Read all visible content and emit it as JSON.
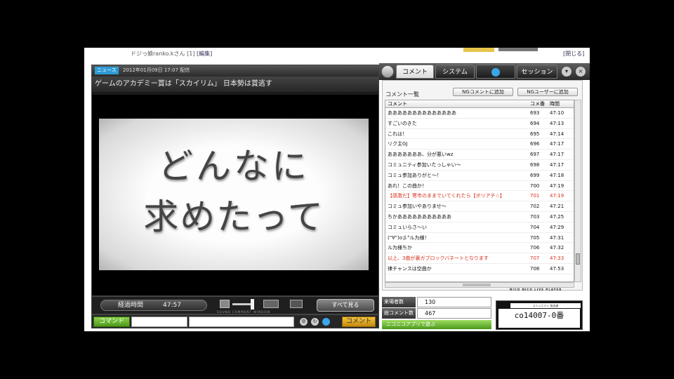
{
  "top": {
    "user": "ドジっ娘ranko.kさん",
    "page_count": "[1]",
    "edit_link": "[編集]",
    "close_link": "[閉じる]"
  },
  "player": {
    "news_tag": "ニュース",
    "datetime": "2012年01月09日 17:07 配信",
    "title": "ゲームのアカデミー賞は「スカイリム」 日本勢は賞逃す",
    "slide_line1": "どんなに",
    "slide_line2": "求めたって"
  },
  "controls": {
    "elapsed_label": "経過時間",
    "elapsed_value": "47:57",
    "control_labels": "SOUND  COMMENT  WINDOW",
    "pill_button": "すべて見る"
  },
  "input": {
    "command_button": "コマンド",
    "command_value": "",
    "comment_value": "",
    "post_button": "コメント"
  },
  "tabs": {
    "comment": "コメント",
    "system": "システム",
    "session": "セッション"
  },
  "comments_panel": {
    "header": "コメント一覧",
    "ng_comment_button": "NGコメントに追加",
    "ng_user_button": "NGユーザーに追加",
    "columns": {
      "comment": "コメント",
      "number": "コメ番",
      "time": "時間"
    },
    "rows": [
      {
        "text": "ああああああああああああああ",
        "no": "693",
        "time": "47:10",
        "red": false
      },
      {
        "text": "すごいのきた",
        "no": "694",
        "time": "47:13",
        "red": false
      },
      {
        "text": "これは！",
        "no": "695",
        "time": "47:14",
        "red": false
      },
      {
        "text": "リク主GJ",
        "no": "696",
        "time": "47:17",
        "red": false
      },
      {
        "text": "あああああああ、分が悪いwz",
        "no": "697",
        "time": "47:17",
        "red": false
      },
      {
        "text": "コミュニティ参加いたっしゃい～",
        "no": "698",
        "time": "47:17",
        "red": false
      },
      {
        "text": "コミュ参加ありがと～！",
        "no": "699",
        "time": "47:18",
        "red": false
      },
      {
        "text": "あれ！この曲か！",
        "no": "700",
        "time": "47:19",
        "red": false
      },
      {
        "text": "【感激だ】寒市のままでいてくれたら【ボリアチ☆】",
        "no": "701",
        "time": "47:19",
        "red": true
      },
      {
        "text": "コミュ参加いやありませ～",
        "no": "702",
        "time": "47:21",
        "red": false
      },
      {
        "text": "ちかあああああああああああ",
        "no": "703",
        "time": "47:25",
        "red": false
      },
      {
        "text": "コミュいらさ～い",
        "no": "704",
        "time": "47:29",
        "red": false
      },
      {
        "text": "(\"∀\")o彡°ル为様！",
        "no": "705",
        "time": "47:31",
        "red": false
      },
      {
        "text": "ル为様ちか",
        "no": "706",
        "time": "47:32",
        "red": false
      },
      {
        "text": "以上、3曲が裏ガブロックバネートとなります",
        "no": "707",
        "time": "47:33",
        "red": true
      },
      {
        "text": "律チャンスは空曲か",
        "no": "708",
        "time": "47:53",
        "red": false
      }
    ],
    "brand": "NICO NICO LIVE PLAYER"
  },
  "stats": {
    "viewers_label": "来場者数",
    "viewers_value": "130",
    "comments_label": "総コメント数",
    "comments_value": "467",
    "app_button": "ニコニコアプリで遊ぶ"
  },
  "community": {
    "header": "コミュニティ 放送者",
    "id": "co14007-0番"
  }
}
